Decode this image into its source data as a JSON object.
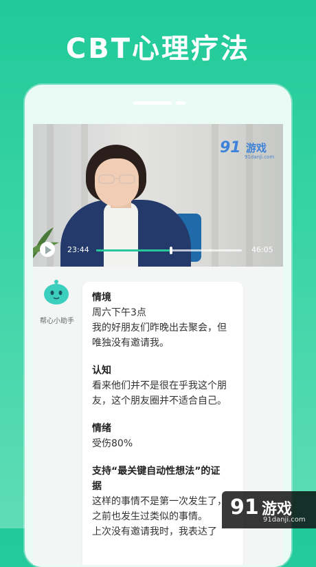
{
  "headline": "CBT心理疗法",
  "video": {
    "current_time": "23:44",
    "total_time": "46:05",
    "progress": 0.515,
    "watermark_logo": "91",
    "watermark_text": "游戏",
    "watermark_url": "91danji.com"
  },
  "assistant": {
    "name": "帮心小助手"
  },
  "message": {
    "situation_title": "情境",
    "situation_line1": "周六下午3点",
    "situation_line2": "我的好朋友们昨晚出去聚会，但",
    "situation_line3": "唯独没有邀请我。",
    "cognition_title": "认知",
    "cognition_line1": "看来他们并不是很在乎我这个朋",
    "cognition_line2": "友，这个朋友圈并不适合自己。",
    "emotion_title": "情绪",
    "emotion_line1": "受伤80%",
    "support_title_line1": "支持“最关键自动性想法”的证",
    "support_title_line2": "据",
    "support_line1": "这样的事情不是第一次发生了，",
    "support_line2": "之前也发生过类似的事情。",
    "support_line3": "上次没有邀请我时，我表达了"
  },
  "bottom_watermark": {
    "logo": "91",
    "text": "游戏",
    "url": "91danji.com"
  }
}
